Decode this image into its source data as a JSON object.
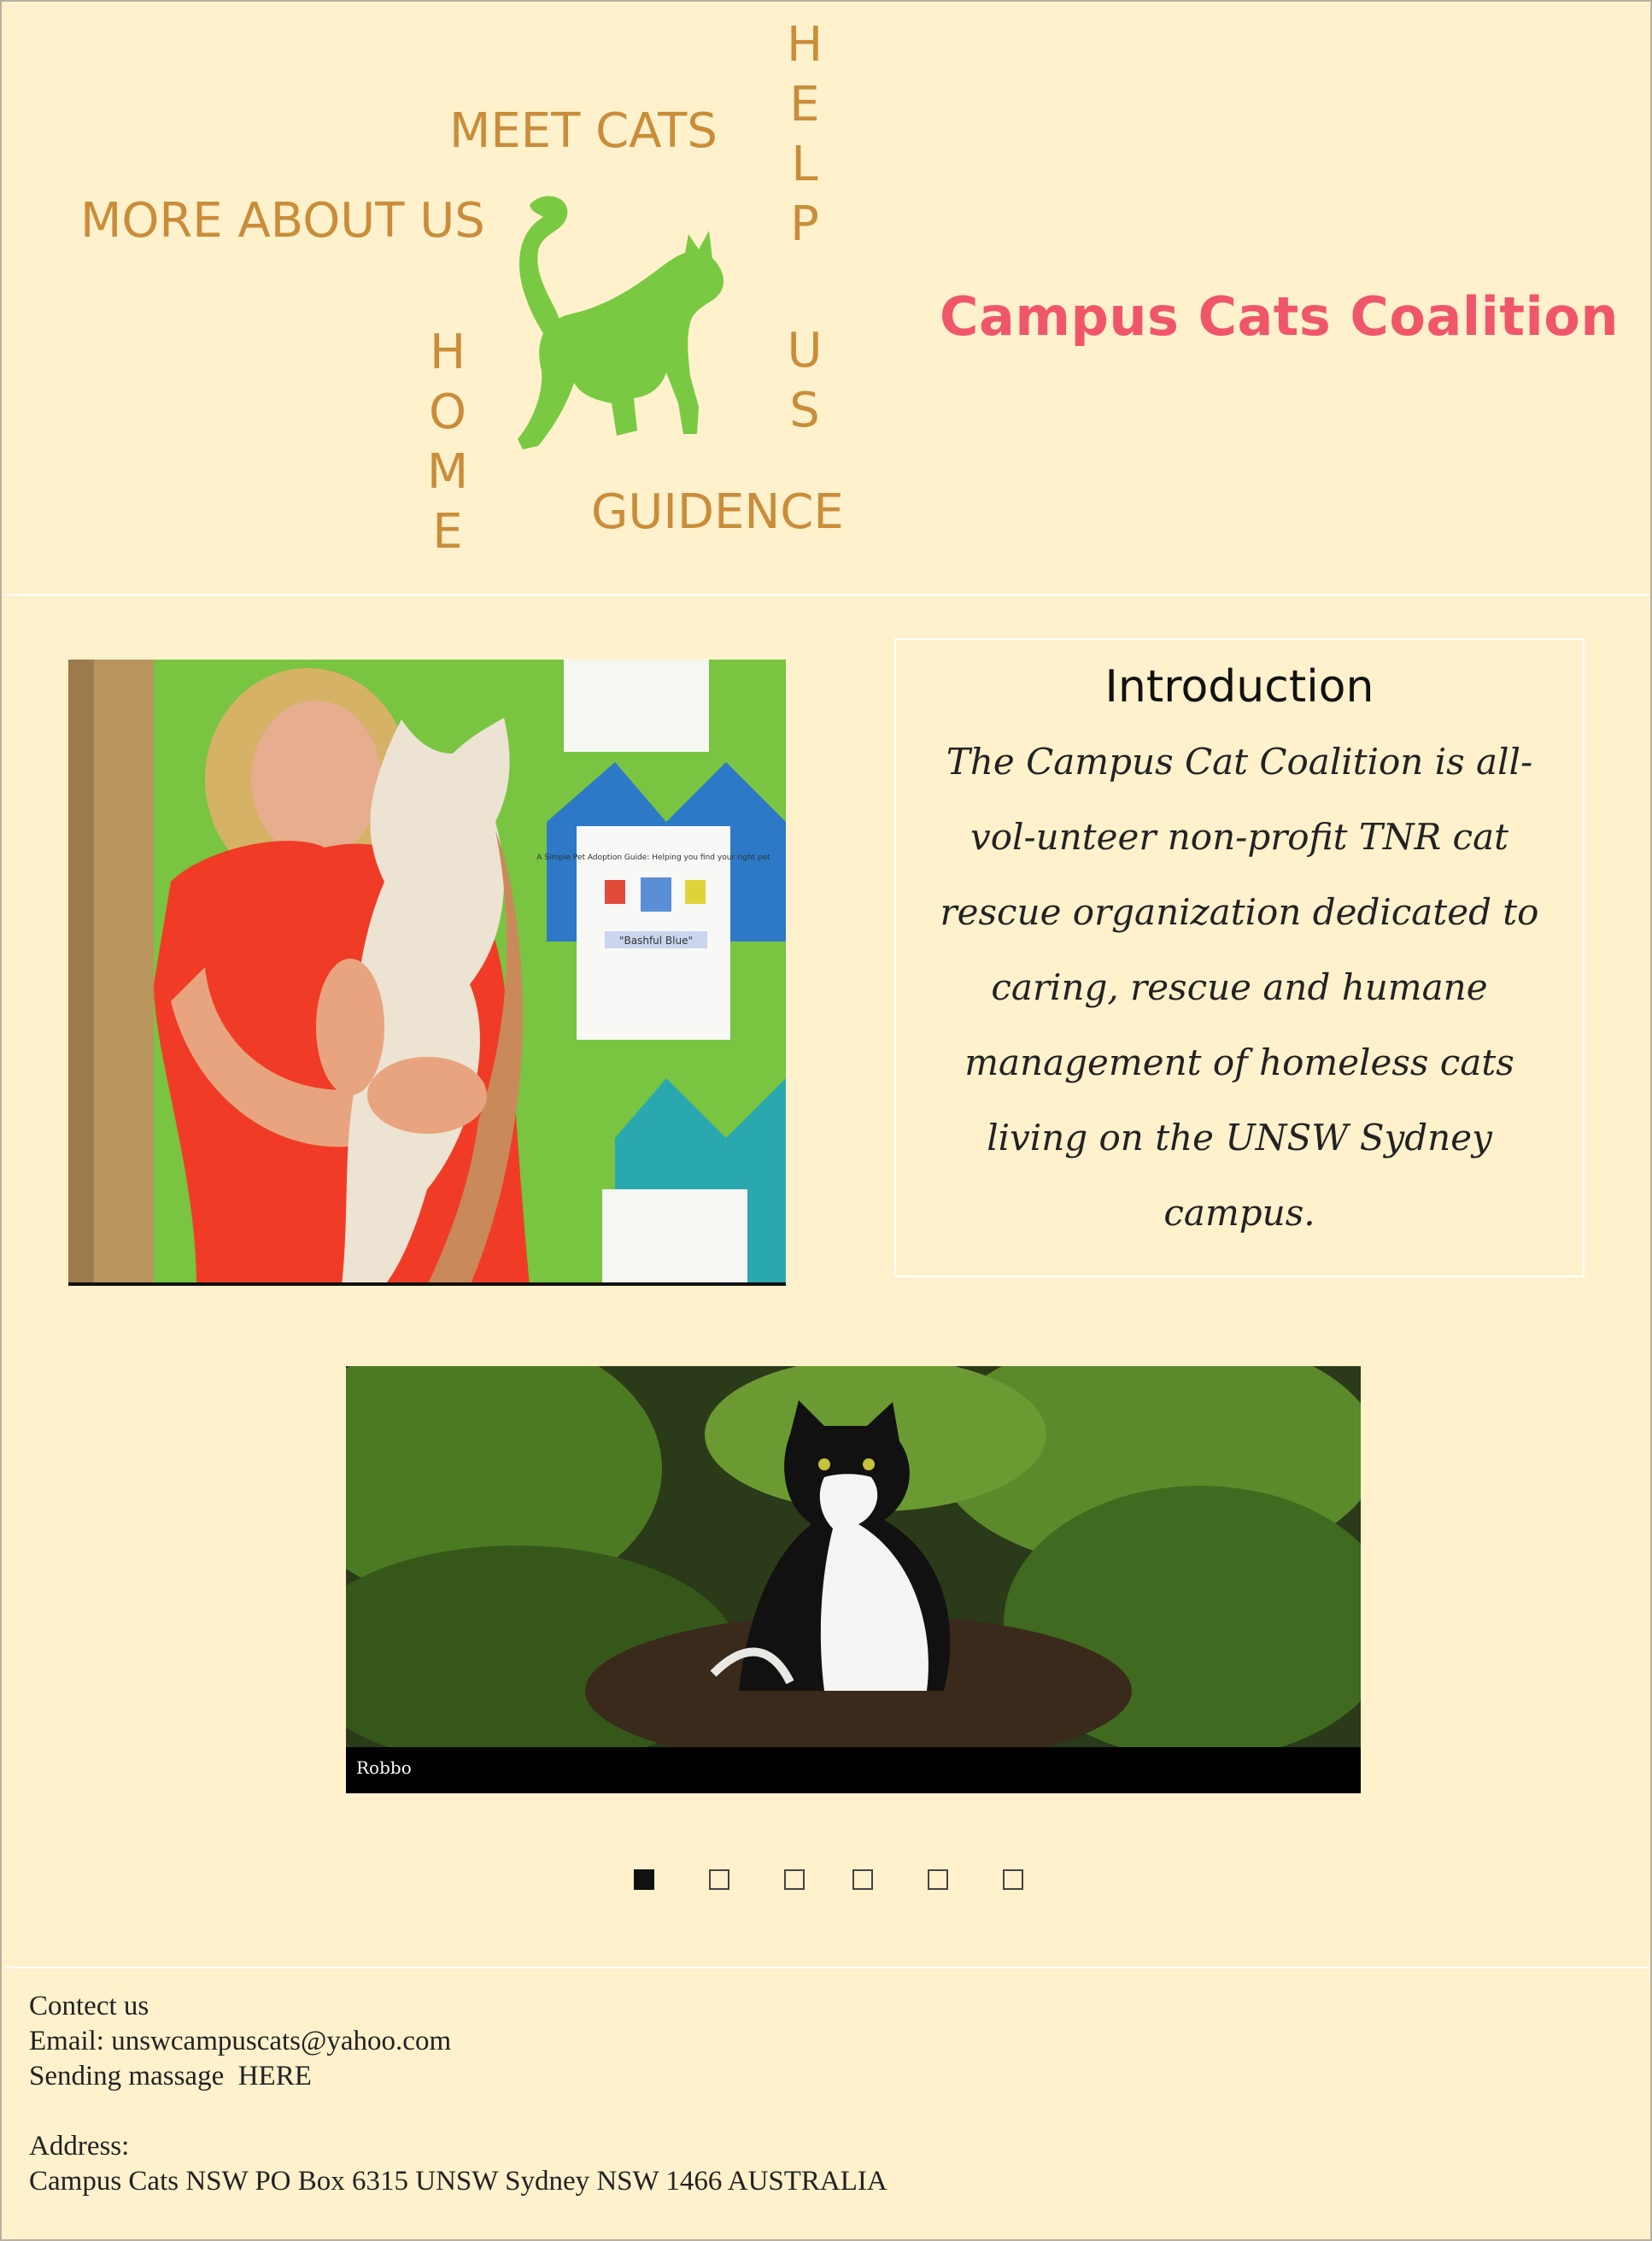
{
  "header": {
    "site_title": "Campus Cats Coalition",
    "nav": {
      "meet_cats": "MEET CATS",
      "more_about_us": "MORE ABOUT US",
      "guidence": "GUIDENCE",
      "home": "HOME",
      "help": "HELP",
      "us": "US"
    },
    "logo_icon": "cat-silhouette-icon",
    "logo_color": "#7ac943"
  },
  "intro": {
    "title": "Introduction",
    "text": "The Campus Cat Coalition is all-vol-unteer non-profit TNR cat rescue organization dedicated to caring, rescue and humane management of homeless cats living on the UNSW Sydney campus."
  },
  "photo1": {
    "poster_title": "A Simple Pet Adoption Guide: Helping you find your right pet",
    "poster_name": "\"Bashful Blue\""
  },
  "slideshow": {
    "caption": "Robbo",
    "dot_count": 6,
    "active_index": 0
  },
  "footer": {
    "contact_label": "Contect us",
    "email": "Email: unswcampuscats@yahoo.com",
    "message_prefix": "Sending massage",
    "message_link": "HERE",
    "address_label": "Address:",
    "address": "Campus Cats NSW PO Box 6315  UNSW Sydney NSW 1466 AUSTRALIA"
  },
  "colors": {
    "background": "#fff1cc",
    "nav": "#c98d3a",
    "title": "#f0566a"
  }
}
